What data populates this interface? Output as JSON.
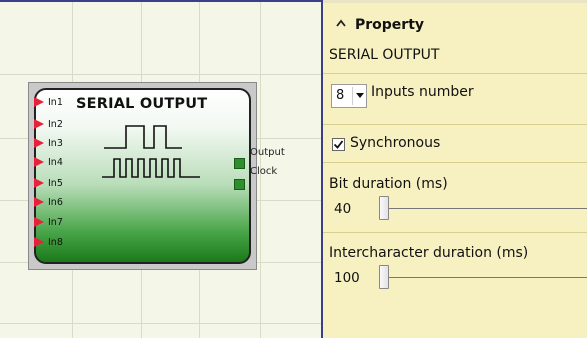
{
  "canvas": {
    "block": {
      "title": "SERIAL OUTPUT",
      "inputs": [
        "In1",
        "In2",
        "In3",
        "In4",
        "In5",
        "In6",
        "In7",
        "In8"
      ],
      "outputs": [
        "Output",
        "Clock"
      ],
      "colors": {
        "gradient_end": "#1a7a1a",
        "input_arrow": "#e8213a",
        "port": "#2e8f2e"
      }
    }
  },
  "panel": {
    "header": "Property",
    "subtitle": "SERIAL OUTPUT",
    "inputs_number": {
      "value": "8",
      "label": "Inputs number"
    },
    "synchronous": {
      "checked": true,
      "label": "Synchronous"
    },
    "bit_duration": {
      "label": "Bit duration (ms)",
      "value": "40"
    },
    "intercharacter_duration": {
      "label": "Intercharacter duration (ms)",
      "value": "100"
    },
    "icons": {
      "collapse": "chevron-up-icon",
      "dropdown": "chevron-down-icon",
      "check": "checkmark-icon"
    },
    "colors": {
      "background": "#f7f1c2",
      "canvas_bg": "#f4f6e8",
      "divider": "#3b3e8c"
    }
  }
}
